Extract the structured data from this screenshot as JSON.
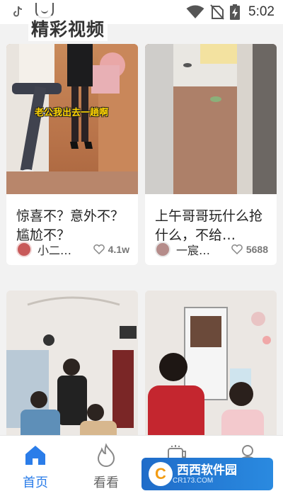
{
  "status_bar": {
    "time": "5:02",
    "icons": [
      "tiktok-notification-icon",
      "wifi-icon",
      "no-sim-icon",
      "battery-charging-icon"
    ]
  },
  "header": {
    "title": "精彩视频",
    "icon": "app-smile-icon"
  },
  "feed": {
    "cards": [
      {
        "thumb_text": "老公我出去一趟啊",
        "caption": "惊喜不？意外不？尴尬不？",
        "author": "小二…",
        "likes": "4.1w"
      },
      {
        "thumb_text": "",
        "caption": "上午哥哥玩什么抢什么，不给…",
        "author": "一宸…",
        "likes": "5688"
      },
      {
        "thumb_text": "",
        "caption": "",
        "author": "",
        "likes": ""
      },
      {
        "thumb_text": "",
        "caption": "",
        "author": "",
        "likes": ""
      }
    ]
  },
  "bottom_nav": {
    "items": [
      {
        "label": "首页",
        "icon": "home-icon",
        "active": true
      },
      {
        "label": "看看",
        "icon": "flame-icon",
        "active": false
      },
      {
        "label": "",
        "icon": "mug-icon",
        "active": false
      },
      {
        "label": "",
        "icon": "user-icon",
        "active": false
      }
    ]
  },
  "watermark": {
    "logo": "C",
    "text": "西西软件园",
    "sub": "CR173.COM"
  },
  "colors": {
    "accent": "#2b7de9",
    "background": "#f2f2f2",
    "caption_text": "#222222",
    "watermark_blue": "#1f6cc9"
  }
}
